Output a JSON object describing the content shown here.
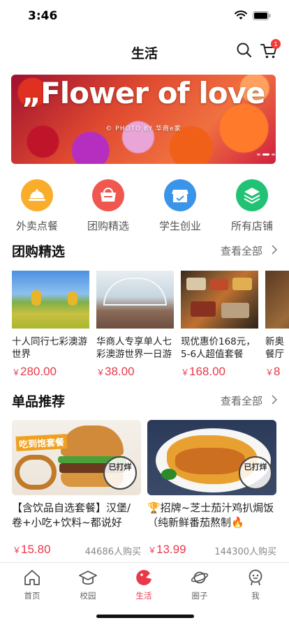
{
  "status_bar": {
    "time": "3:46"
  },
  "nav": {
    "title": "生活",
    "cart_badge": "1"
  },
  "banner": {
    "title": "„Flower of love",
    "subtitle": "© PHOTO BY 华商e家"
  },
  "categories": [
    {
      "label": "外卖点餐",
      "icon": "takeout-icon",
      "color": "#f9a825"
    },
    {
      "label": "团购精选",
      "icon": "shopping-basket-icon",
      "color": "#f0504a"
    },
    {
      "label": "学生创业",
      "icon": "store-icon",
      "color": "#2f8fe8"
    },
    {
      "label": "所有店铺",
      "icon": "layers-icon",
      "color": "#1ec070"
    }
  ],
  "group_buy": {
    "title": "团购精选",
    "see_all": "查看全部",
    "items": [
      {
        "name": "十人同行七彩澳游世界",
        "currency": "￥",
        "price": "280.00"
      },
      {
        "name": "华商人专享单人七彩澳游世界一日游",
        "currency": "￥",
        "price": "38.00"
      },
      {
        "name": "现优惠价168元，5-6人超值套餐",
        "currency": "￥",
        "price": "168.00"
      },
      {
        "name": "新奥餐厅",
        "currency": "￥",
        "price": "8"
      }
    ]
  },
  "products": {
    "title": "单品推荐",
    "see_all": "查看全部",
    "items": [
      {
        "name": "【含饮品自选套餐】汉堡/卷+小吃+饮料~都说好吃...",
        "currency": "￥",
        "price": "15.80",
        "sold": "44686人购买",
        "stamp": "已打烊",
        "overlay": "吃到饱套餐"
      },
      {
        "name": "🏆招牌~芝士茄汁鸡扒焗饭（纯新鲜番茄熬制🔥",
        "currency": "￥",
        "price": "13.99",
        "sold": "144300人购买",
        "stamp": "已打烊"
      }
    ]
  },
  "tabs": [
    {
      "label": "首页",
      "icon": "home-icon",
      "active": false
    },
    {
      "label": "校园",
      "icon": "campus-icon",
      "active": false
    },
    {
      "label": "生活",
      "icon": "life-icon",
      "active": true
    },
    {
      "label": "圈子",
      "icon": "planet-icon",
      "active": false
    },
    {
      "label": "我",
      "icon": "profile-icon",
      "active": false
    }
  ],
  "colors": {
    "accent": "#e8394a",
    "badge": "#f23a3a"
  }
}
